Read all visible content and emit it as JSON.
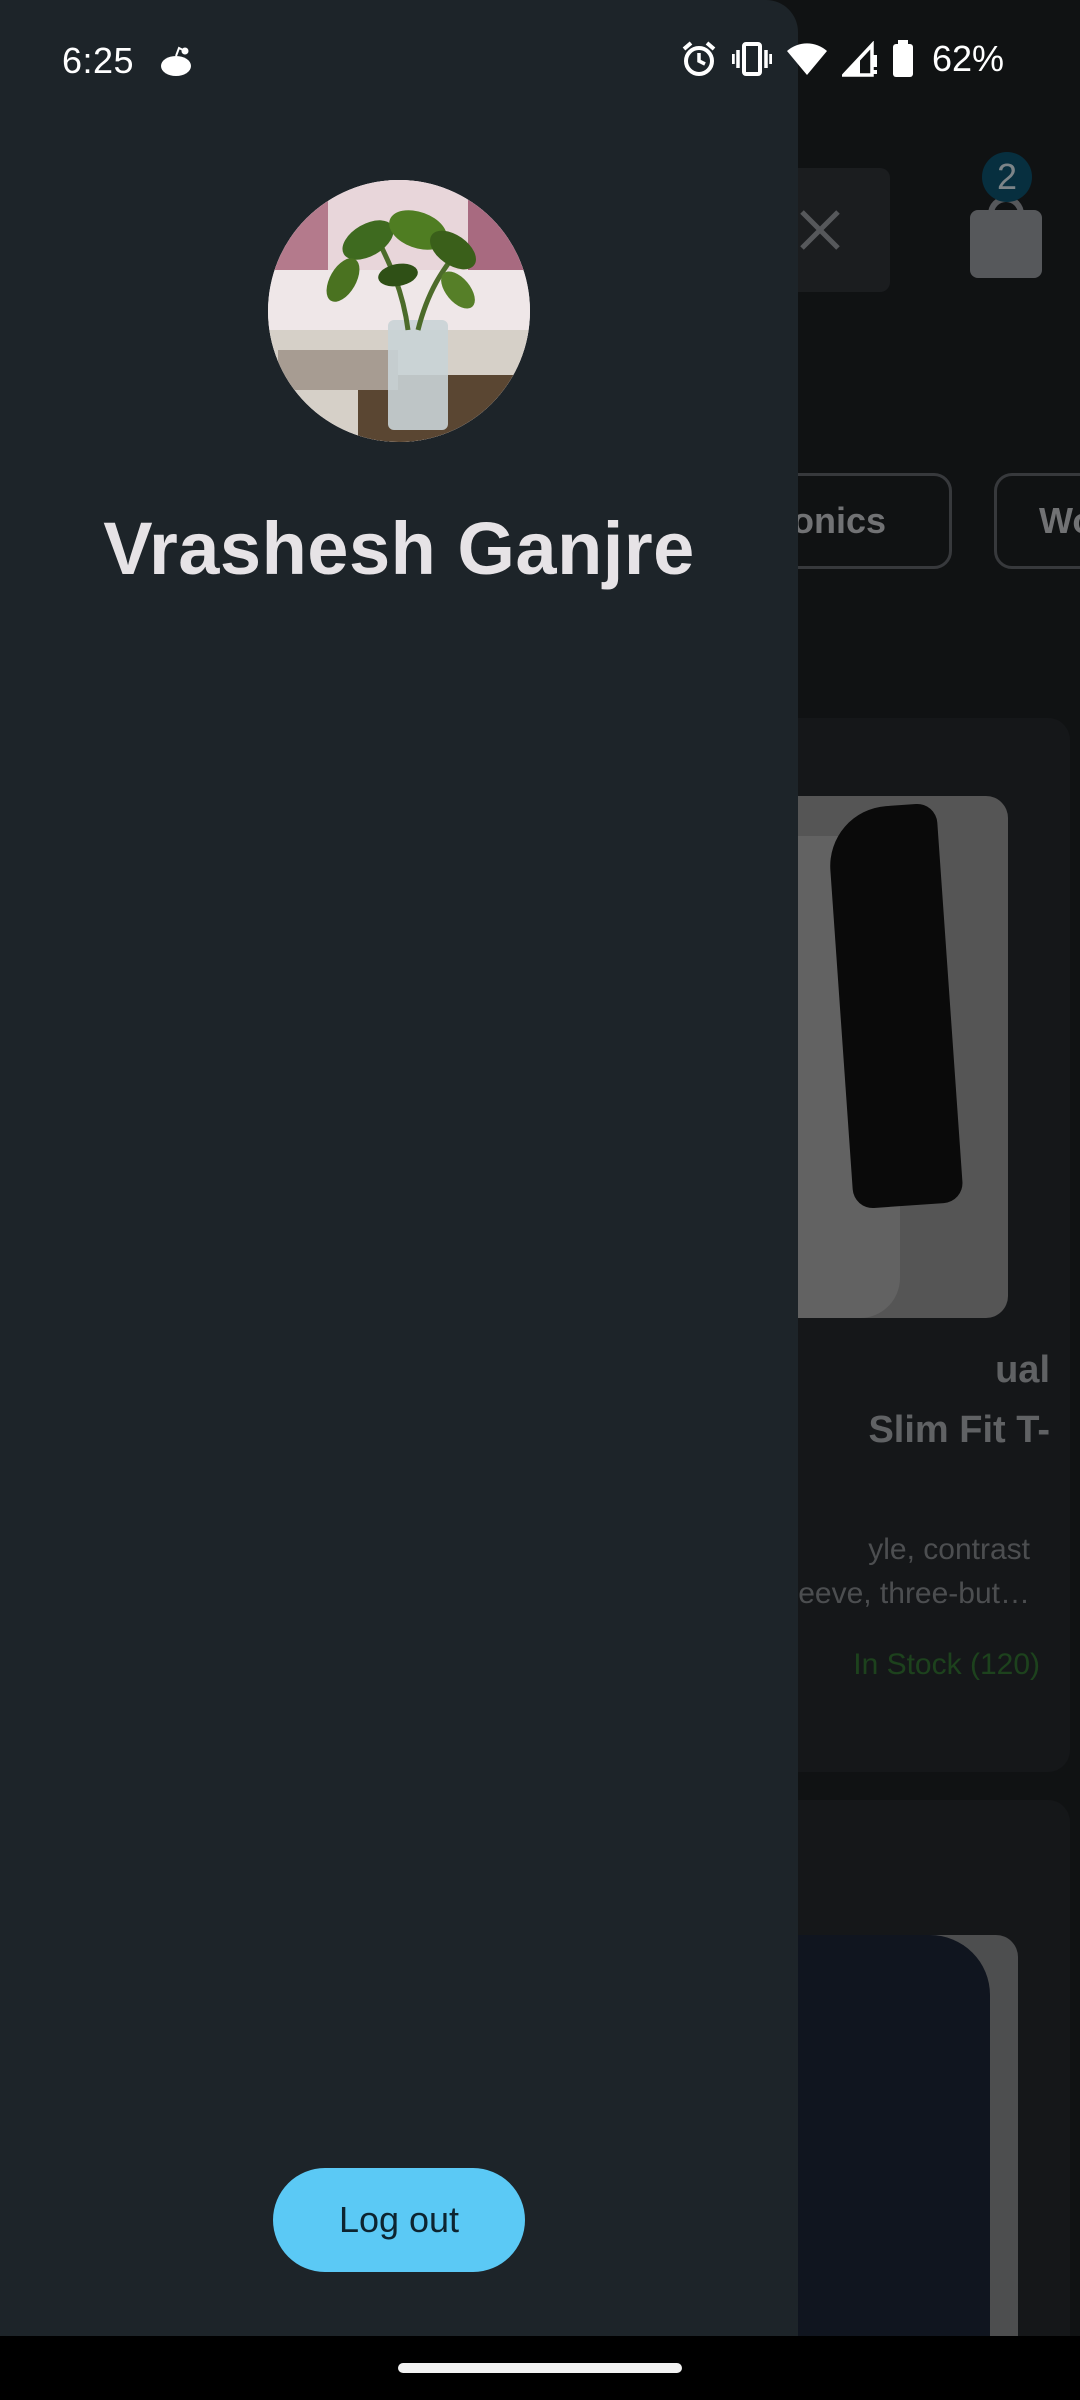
{
  "status_bar": {
    "time": "6:25",
    "battery": "62%",
    "icons": [
      "reddit-icon",
      "alarm-icon",
      "vibrate-icon",
      "wifi-icon",
      "cellular-signal-icon",
      "battery-icon"
    ]
  },
  "drawer": {
    "user_name": "Vrashesh Ganjre",
    "logout_label": "Log out",
    "accent_color": "#5bc9f5"
  },
  "background_app": {
    "cart_count": "2",
    "categories": [
      "tronics",
      "Wo"
    ],
    "product_1": {
      "title": "ual\nSlim Fit T-",
      "description": "yle, contrast\neeve, three-but…",
      "stock": "In Stock (120)"
    }
  }
}
